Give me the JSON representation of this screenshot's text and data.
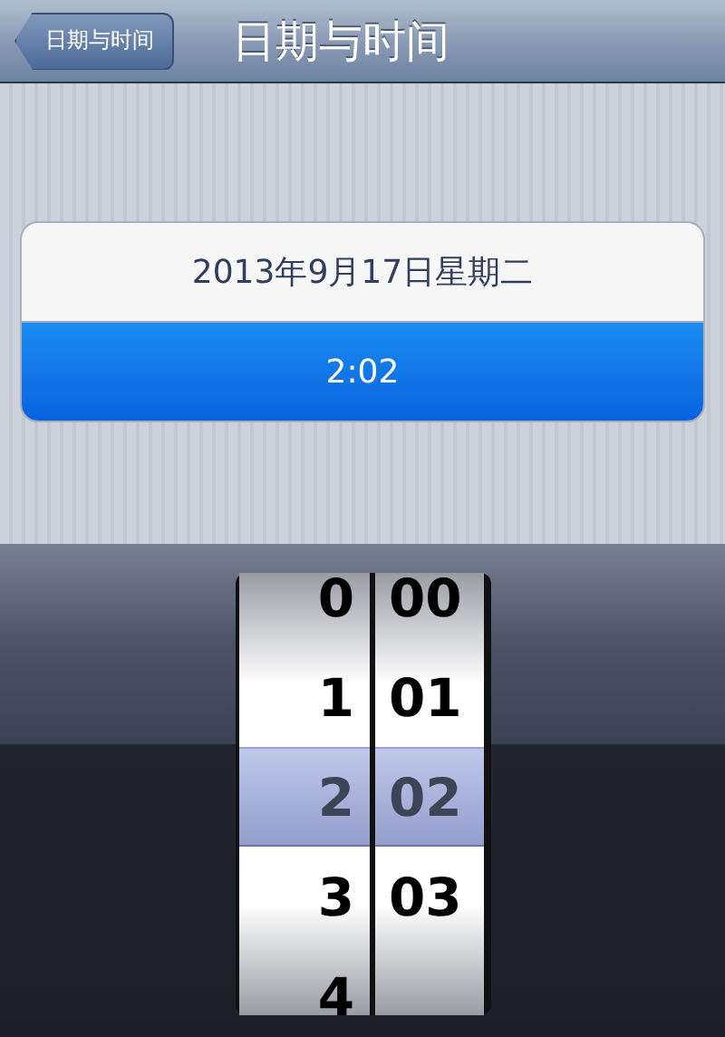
{
  "nav": {
    "back_button": "日期与时间",
    "title": "日期与时间"
  },
  "settings": [
    {
      "label": "2013年9月17日星期二",
      "selected": false
    },
    {
      "label": "2:02",
      "selected": true
    }
  ],
  "picker": {
    "columns": [
      {
        "items": [
          {
            "value": "0",
            "selected": false
          },
          {
            "value": "1",
            "selected": false
          },
          {
            "value": "2",
            "selected": true
          },
          {
            "value": "3",
            "selected": false
          },
          {
            "value": "4",
            "selected": false
          }
        ]
      },
      {
        "items": [
          {
            "value": "00",
            "selected": false
          },
          {
            "value": "01",
            "selected": false
          },
          {
            "value": "02",
            "selected": true
          },
          {
            "value": "03",
            "selected": false
          }
        ]
      }
    ]
  }
}
